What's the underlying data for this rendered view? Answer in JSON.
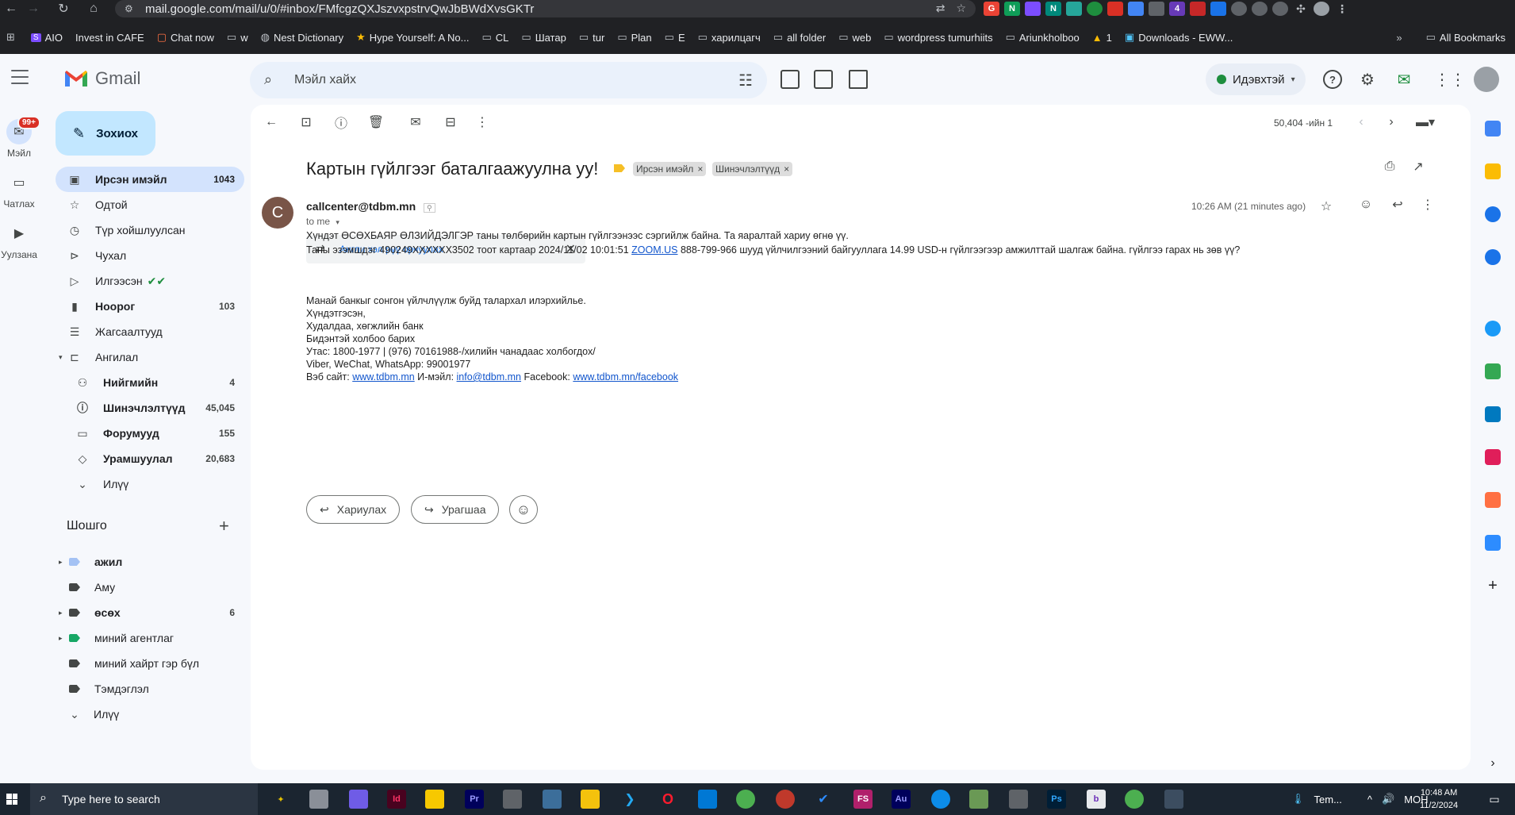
{
  "browser": {
    "url": "mail.google.com/mail/u/0/#inbox/FMfcgzQXJszvxpstrvQwJbBWdXvsGKTr",
    "bookmarks": [
      "AIO",
      "Invest in CAFE",
      "Chat now",
      "w",
      "Nest Dictionary",
      "Hype Yourself: A No...",
      "CL",
      "Шатар",
      "tur",
      "Plan",
      "E",
      "харилцагч",
      "all folder",
      "web",
      "wordpress tumurhiits",
      "Ariunkholboo",
      "1",
      "Downloads - EWW..."
    ],
    "all_bookmarks": "All Bookmarks"
  },
  "gmail": {
    "logo_text": "Gmail",
    "search_placeholder": "Мэйл хайх",
    "status": "Идэвхтэй",
    "accent": "#0b57d0"
  },
  "rail": {
    "mail": "Мэйл",
    "mail_badge": "99+",
    "chat": "Чатлах",
    "meet": "Уулзана"
  },
  "sidebar": {
    "compose": "Зохиох",
    "nav": [
      {
        "label": "Ирсэн имэйл",
        "count": "1043"
      },
      {
        "label": "Одтой",
        "count": ""
      },
      {
        "label": "Түр хойшлуулсан",
        "count": ""
      },
      {
        "label": "Чухал",
        "count": ""
      },
      {
        "label": "Илгээсэн",
        "count": ""
      },
      {
        "label": "Ноорог",
        "count": "103"
      },
      {
        "label": "Жагсаалтууд",
        "count": ""
      },
      {
        "label": "Ангилал",
        "count": ""
      },
      {
        "label": "Нийгмийн",
        "count": "4"
      },
      {
        "label": "Шинэчлэлтүүд",
        "count": "45,045"
      },
      {
        "label": "Форумууд",
        "count": "155"
      },
      {
        "label": "Урамшуулал",
        "count": "20,683"
      },
      {
        "label": "Илүү",
        "count": ""
      }
    ],
    "labels_title": "Шошго",
    "labels": [
      {
        "label": "ажил",
        "count": "",
        "color": "#a4c2f4"
      },
      {
        "label": "Аму",
        "count": "",
        "color": "#444746"
      },
      {
        "label": "өсөх",
        "count": "6",
        "color": "#444746"
      },
      {
        "label": "миний агентлаг",
        "count": "",
        "color": "#16a765"
      },
      {
        "label": "миний хайрт гэр бүл",
        "count": "",
        "color": "#444746"
      },
      {
        "label": "Тэмдэглэл",
        "count": "",
        "color": "#444746"
      },
      {
        "label": "Илүү",
        "count": "",
        "color": ""
      }
    ]
  },
  "email": {
    "pager": "50,404 -ийн 1",
    "subject": "Картын гүйлгээг баталгаажуулна уу!",
    "chips": [
      "Ирсэн имэйл",
      "Шинэчлэлтүүд"
    ],
    "sender_initial": "C",
    "sender": "callcenter@tdbm.mn",
    "to": "to me",
    "time": "10:26 AM (21 minutes ago)",
    "translate": "Англи хэл рүү орчуулах",
    "body": {
      "line1": "Хүндэт ӨСӨХБАЯР ӨЛЗИЙДЭЛГЭР таны төлбөрийн картын гүйлгээнээс сэргийлж байна. Та яаралтай хариу өгнө үү.",
      "line2_a": "Таны эзэмшдэг 490249XXXXXX3502 тоот картаар 2024/11/02 10:01:51 ",
      "line2_link": "ZOOM.US",
      "line2_b": " 888-799-966 шууд үйлчилгээний байгууллага 14.99 USD-н гүйлгээгээр амжилттай шалгаж байна. гүйлгээ гарах нь зөв үү?",
      "line3": "Манай банкыг сонгон үйлчлүүлж буйд талархал илэрхийлье.",
      "line4": "Хүндэтгэсэн,",
      "line5": "Худалдаа, хөгжлийн банк",
      "line6": "Бидэнтэй холбоо барих",
      "line7": "Утас: 1800-1977 | (976) 70161988-/хилийн чанадаас холбогдох/",
      "line8": "Viber, WeChat, WhatsApp: 99001977",
      "line9_a": "Вэб сайт: ",
      "line9_web": "www.tdbm.mn",
      "line9_b": " И-мэйл: ",
      "line9_mail": "info@tdbm.mn",
      "line9_c": " Facebook: ",
      "line9_fb": "www.tdbm.mn/facebook"
    },
    "reply": "Хариулах",
    "forward": "Урагшаа"
  },
  "taskbar": {
    "search": "Type here to search",
    "weather": "Tem...",
    "lang": "МОН",
    "time": "10:48 AM",
    "date": "11/2/2024"
  }
}
